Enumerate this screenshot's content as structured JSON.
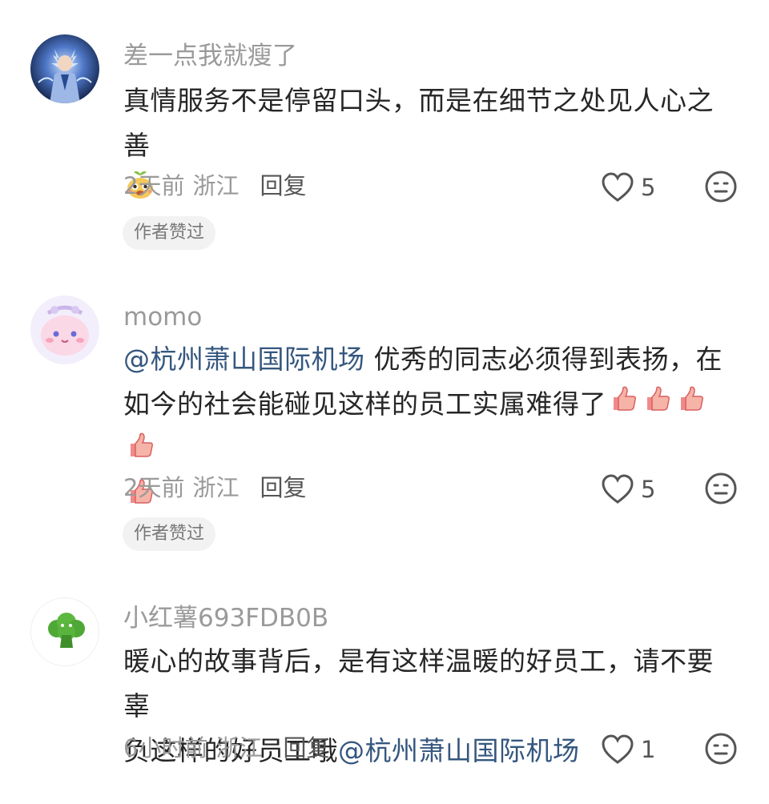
{
  "comments": [
    {
      "username": "差一点我就瘦了",
      "text": "真情服务不是停留口头，而是在细节之处见人心之善",
      "time": "2天前",
      "location": "浙江",
      "reply_label": "回复",
      "likes": "5",
      "badge": "作者赞过",
      "avatar_icon": "anime-character-avatar",
      "emoji": [
        "sprout-face-emoji"
      ]
    },
    {
      "username": "momo",
      "mention": "@杭州萧山国际机场",
      "text_line1": "优秀的同志必须得到表扬，在",
      "text_line2": "如今的社会能碰见这样的员工实属难得了",
      "time": "2天前",
      "location": "浙江",
      "reply_label": "回复",
      "likes": "5",
      "badge": "作者赞过",
      "avatar_icon": "pink-cartoon-avatar",
      "emoji": [
        "thumbs-up-emoji",
        "thumbs-up-emoji",
        "thumbs-up-emoji",
        "thumbs-up-emoji",
        "thumbs-up-emoji"
      ]
    },
    {
      "username": "小红薯693FDB0B",
      "text_line1": "暖心的故事背后，是有这样温暖的好员工，请不要辜",
      "text_line2": "负这样的好员工哦",
      "mention": "@杭州萧山国际机场",
      "time": "6小时前",
      "location": "浙江",
      "reply_label": "回复",
      "likes": "1",
      "avatar_icon": "broccoli-avatar"
    }
  ],
  "colors": {
    "mention": "#35577f",
    "meta_gray": "#9a9a9a",
    "badge_bg": "#f2f2f2"
  }
}
